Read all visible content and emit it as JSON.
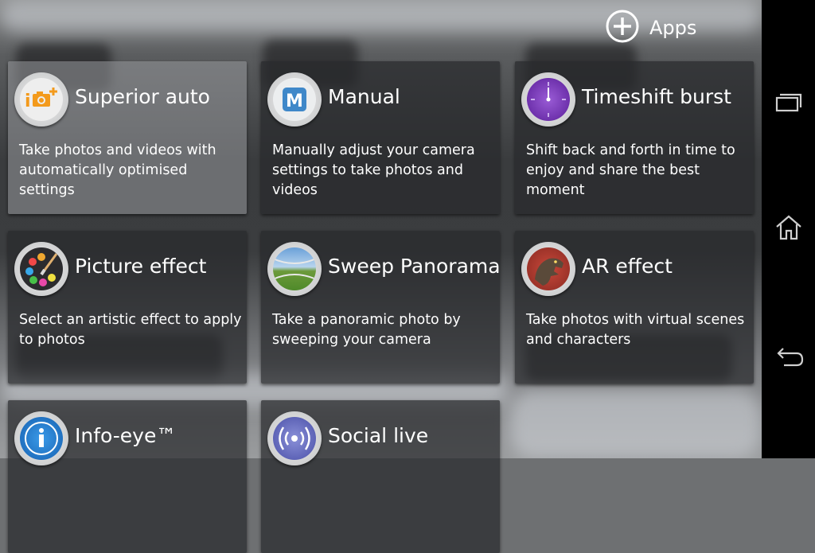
{
  "header": {
    "apps_label": "Apps",
    "apps_icon": "plus-circle-icon"
  },
  "modes": [
    {
      "title": "Superior auto",
      "description": "Take photos and videos with automatically optimised settings",
      "icon": "camera-plus-icon",
      "selected": true
    },
    {
      "title": "Manual",
      "description": "Manually adjust your camera settings to take photos and videos",
      "icon": "manual-m-icon",
      "selected": false
    },
    {
      "title": "Timeshift burst",
      "description": "Shift back and forth in time to enjoy and share the best moment",
      "icon": "clock-icon",
      "selected": false
    },
    {
      "title": "Picture effect",
      "description": "Select an artistic effect to apply to photos",
      "icon": "palette-icon",
      "selected": false
    },
    {
      "title": "Sweep Panorama",
      "description": "Take a panoramic photo by sweeping your camera",
      "icon": "panorama-icon",
      "selected": false
    },
    {
      "title": "AR effect",
      "description": "Take photos with virtual scenes and characters",
      "icon": "dinosaur-icon",
      "selected": false
    },
    {
      "title": "Info-eye™",
      "description": "",
      "icon": "info-icon",
      "selected": false
    },
    {
      "title": "Social live",
      "description": "",
      "icon": "broadcast-icon",
      "selected": false
    }
  ],
  "navbar": {
    "recent_icon": "recent-apps-icon",
    "home_icon": "home-icon",
    "back_icon": "back-icon"
  },
  "colors": {
    "nav_bg": "#000000",
    "tile_bg": "#2a2c2e",
    "selected_tile_bg": "#969899"
  }
}
